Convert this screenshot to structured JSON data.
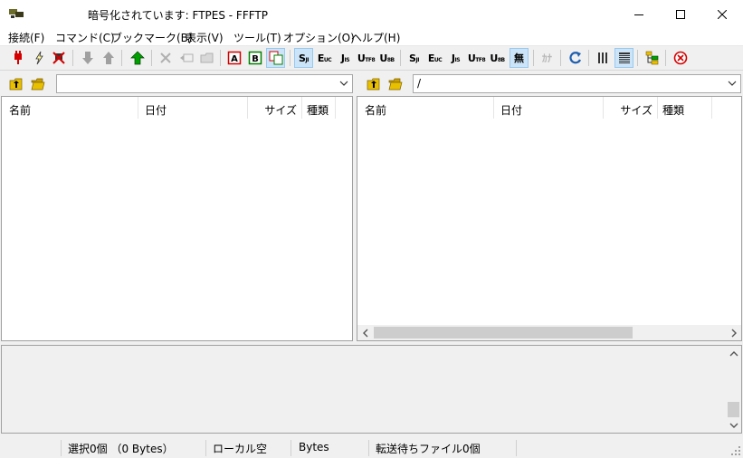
{
  "window": {
    "title": "暗号化されています: FTPES - FFFTP",
    "app_icon": "ffftp-app-icon",
    "controls": [
      "minimize-icon",
      "maximize-icon",
      "close-icon"
    ]
  },
  "menubar": {
    "items": [
      {
        "label": "接続(F)"
      },
      {
        "label": "コマンド(C)"
      },
      {
        "label": "ブックマーク(B)"
      },
      {
        "label": "表示(V)"
      },
      {
        "label": "ツール(T)"
      },
      {
        "label": "オプション(O)"
      },
      {
        "label": "ヘルプ(H)"
      }
    ]
  },
  "toolbar": {
    "encoding": {
      "sjis": {
        "main": "S",
        "sub": "JI"
      },
      "euc": {
        "main": "E",
        "sub": "UC"
      },
      "jis": {
        "main": "J",
        "sub": "IS"
      },
      "utf8": {
        "main": "U",
        "sub": "TF8"
      },
      "utf8bom": {
        "main": "U",
        "sub": "8B"
      },
      "none": {
        "label": "無"
      }
    },
    "kana_label": "ｶﾅ",
    "transfer_modes": [
      "A",
      "B"
    ]
  },
  "local": {
    "path": "",
    "columns": [
      {
        "label": "名前"
      },
      {
        "label": "日付"
      },
      {
        "label": "サイズ"
      },
      {
        "label": "種類"
      }
    ]
  },
  "remote": {
    "path": "/",
    "columns": [
      {
        "label": "名前"
      },
      {
        "label": "日付"
      },
      {
        "label": "サイズ"
      },
      {
        "label": "種類"
      }
    ]
  },
  "statusbar": {
    "selection": "選択0個 （0 Bytes）",
    "local_space": "ローカル空",
    "bytes": "Bytes",
    "queue": "転送待ちファイル0個"
  },
  "colors": {
    "connect_red": "#d40000",
    "folder_yellow": "#e8c000",
    "upload_green": "#00a000",
    "pressed_bg": "#cce4f7",
    "refresh_blue": "#1f5fb0"
  }
}
